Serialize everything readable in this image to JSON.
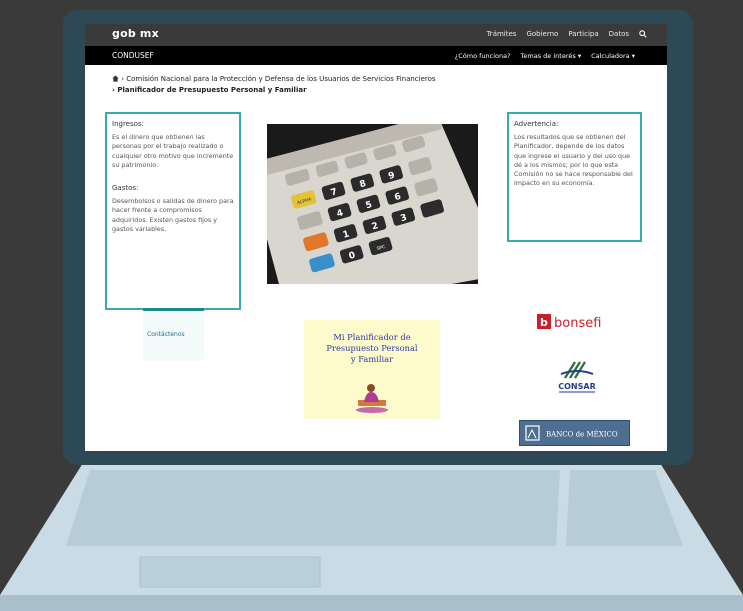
{
  "header": {
    "brand": "gob mx",
    "nav": [
      "Trámites",
      "Gobierno",
      "Participa",
      "Datos"
    ]
  },
  "subheader": {
    "brand": "CONDUSEF",
    "nav": [
      "¿Cómo funciona?",
      "Temas de interés ▾",
      "Calculadora ▾"
    ]
  },
  "breadcrumb": {
    "item1": "Comisión Nacional para la Protección y Defensa de los Usuarios de Servicios Financieros",
    "item2": "Planificador de Presupuesto Personal y Familiar"
  },
  "ingresos": {
    "title": "Ingresos:",
    "text": "Es el dinero que obtienen las personas por el trabajo realizado o cualquier otro motivo que incremente su patrimonio."
  },
  "gastos": {
    "title": "Gastos:",
    "text": "Desembolsos o salidas de dinero para hacer frente a compromisos adquiridos. Existen gastos fijos y gastos variables."
  },
  "advertencia": {
    "title": "Advertencia:",
    "text": "Los resultados que se obtienen del Planificador, depende de los datos que ingrese el usuario y del uso que dé a los mismos; por lo que esta Comisión no se hace responsable del impacto en su economía."
  },
  "contact": {
    "label": "Contáctenos"
  },
  "planner": {
    "line1": "Mi Planificador de",
    "line2": "Presupuesto Personal",
    "line3": "y Familiar"
  },
  "logos": {
    "bonsefi": "bonsefi",
    "consar": "CONSAR",
    "banxico": "BANCO de MÉXICO"
  },
  "calc_keys": [
    "7",
    "8",
    "9",
    "4",
    "5",
    "6",
    "1",
    "2",
    "3",
    "0",
    "ALPHA",
    "SPC"
  ],
  "colors": {
    "accent": "#3aa8ad",
    "topbar": "#3a3a3a",
    "subbar": "#000000",
    "laptop": "#2e4956",
    "base": "#c3d8e2"
  }
}
